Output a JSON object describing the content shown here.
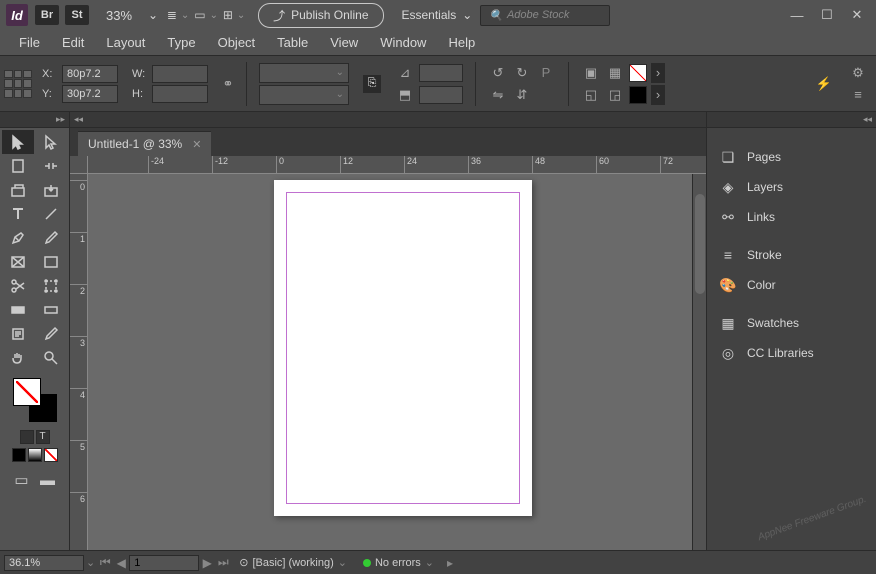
{
  "titlebar": {
    "app": "Id",
    "badges": [
      "Br",
      "St"
    ],
    "zoom": "33%",
    "publish_label": "Publish Online",
    "workspace": "Essentials",
    "search_placeholder": "Adobe Stock"
  },
  "menus": [
    "File",
    "Edit",
    "Layout",
    "Type",
    "Object",
    "Table",
    "View",
    "Window",
    "Help"
  ],
  "control": {
    "x_label": "X:",
    "x_value": "80p7.2",
    "y_label": "Y:",
    "y_value": "30p7.2",
    "w_label": "W:",
    "w_value": "",
    "h_label": "H:",
    "h_value": ""
  },
  "document": {
    "tab_title": "Untitled-1 @ 33%",
    "ruler_h": [
      "-24",
      "-12",
      "0",
      "12",
      "24",
      "36",
      "48",
      "60",
      "72"
    ],
    "ruler_v": [
      "0",
      "1",
      "2",
      "3",
      "4",
      "5",
      "6"
    ]
  },
  "panels": [
    {
      "icon": "pages",
      "label": "Pages"
    },
    {
      "icon": "layers",
      "label": "Layers"
    },
    {
      "icon": "links",
      "label": "Links"
    },
    {
      "sep": true
    },
    {
      "icon": "stroke",
      "label": "Stroke"
    },
    {
      "icon": "color",
      "label": "Color"
    },
    {
      "sep": true
    },
    {
      "icon": "swatches",
      "label": "Swatches"
    },
    {
      "icon": "cc",
      "label": "CC Libraries"
    }
  ],
  "status": {
    "zoom": "36.1%",
    "page": "1",
    "preset": "[Basic] (working)",
    "errors": "No errors"
  }
}
